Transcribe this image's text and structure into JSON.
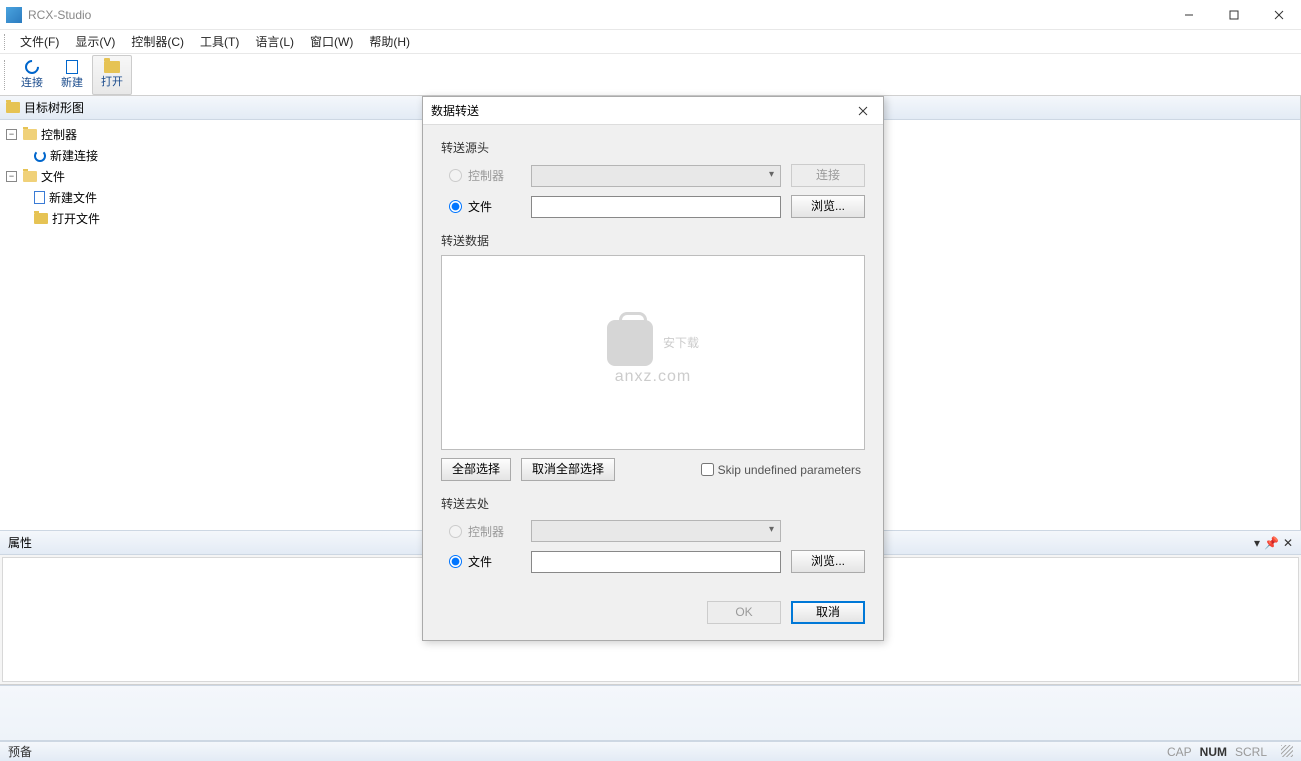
{
  "app": {
    "title": "RCX-Studio"
  },
  "menu": {
    "file": "文件(F)",
    "view": "显示(V)",
    "controller": "控制器(C)",
    "tool": "工具(T)",
    "language": "语言(L)",
    "window": "窗口(W)",
    "help": "帮助(H)"
  },
  "toolbar": {
    "connect": "连接",
    "new": "新建",
    "open": "打开"
  },
  "tree": {
    "root": "目标树形图",
    "controller": "控制器",
    "new_connection": "新建连接",
    "file": "文件",
    "new_file": "新建文件",
    "open_file": "打开文件"
  },
  "panels": {
    "properties": "属性"
  },
  "status": {
    "ready": "预备",
    "cap": "CAP",
    "num": "NUM",
    "scrl": "SCRL"
  },
  "dialog": {
    "title": "数据转送",
    "source_label": "转送源头",
    "radio_controller": "控制器",
    "radio_file": "文件",
    "connect_btn": "连接",
    "browse_btn": "浏览...",
    "data_label": "转送数据",
    "select_all": "全部选择",
    "deselect_all": "取消全部选择",
    "skip_checkbox": "Skip undefined parameters",
    "dest_label": "转送去处",
    "ok": "OK",
    "cancel": "取消",
    "source_file_value": "",
    "dest_file_value": "",
    "watermark_main": "安下载",
    "watermark_sub": "anxz.com"
  }
}
